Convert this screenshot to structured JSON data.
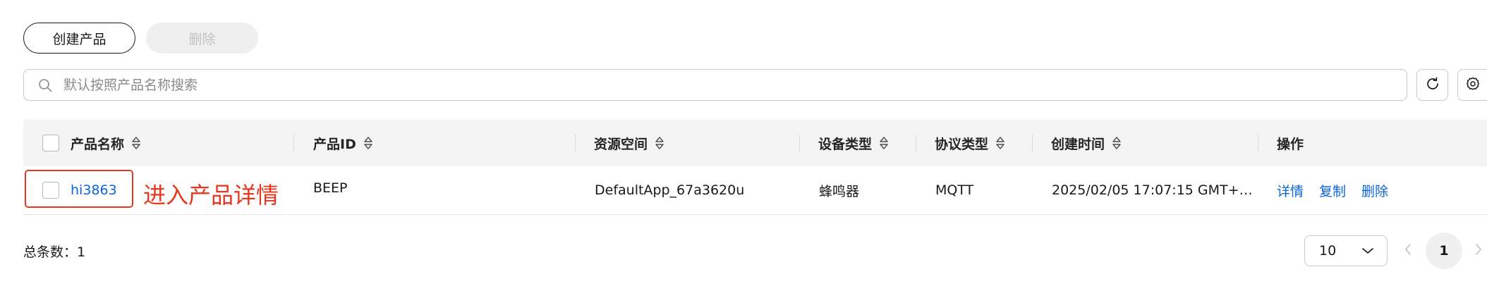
{
  "toolbar": {
    "create_label": "创建产品",
    "delete_label": "删除"
  },
  "search": {
    "placeholder": "默认按照产品名称搜索",
    "value": ""
  },
  "table": {
    "columns": [
      "产品名称",
      "产品ID",
      "资源空间",
      "设备类型",
      "协议类型",
      "创建时间",
      "操作"
    ],
    "rows": [
      {
        "name": "hi3863",
        "id": "BEEP",
        "space": "DefaultApp_67a3620u",
        "device_type": "蜂鸣器",
        "protocol": "MQTT",
        "created": "2025/02/05 17:07:15 GMT+…",
        "actions": [
          "详情",
          "复制",
          "删除"
        ]
      }
    ]
  },
  "annotation": {
    "text": "进入产品详情",
    "color": "#e8371e"
  },
  "footer": {
    "total_label": "总条数：1",
    "page_size": "10",
    "current_page": "1"
  },
  "colors": {
    "link": "#0c64d9",
    "header_bg": "#f4f4f4"
  }
}
